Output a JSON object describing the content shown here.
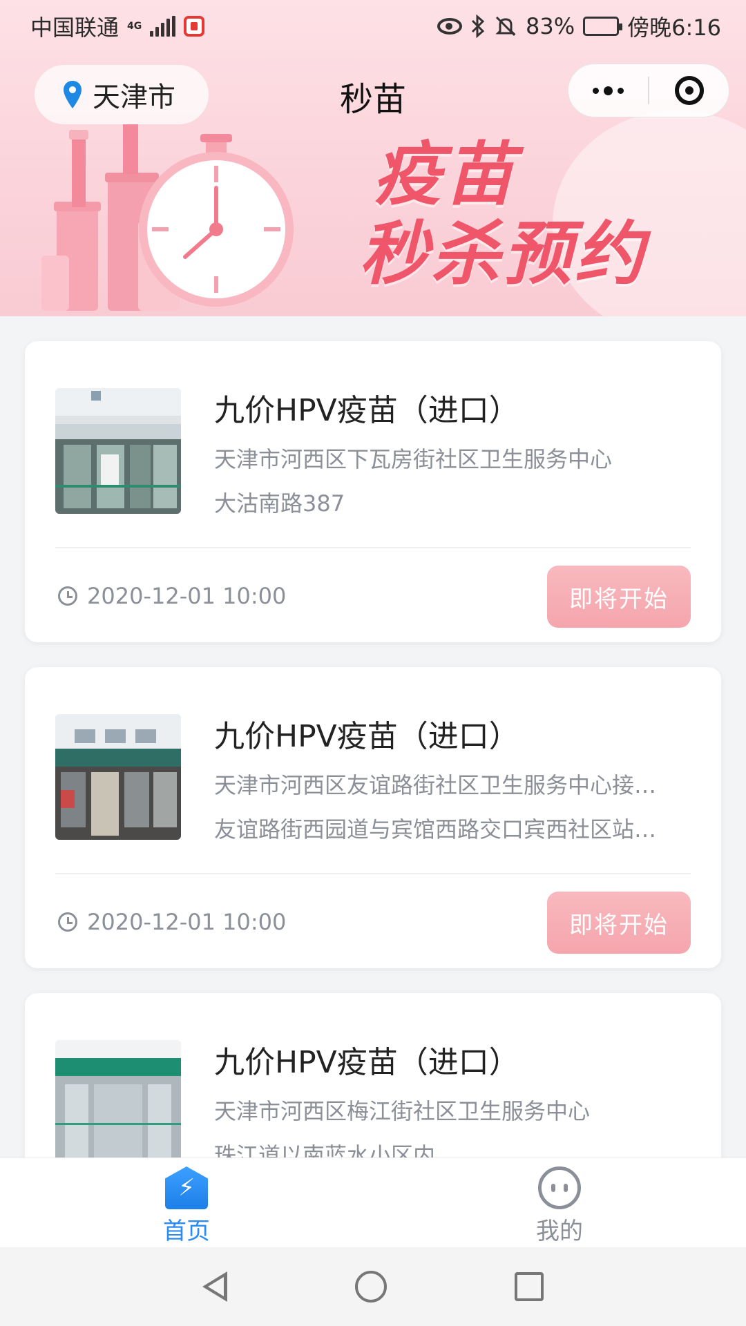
{
  "status_bar": {
    "carrier": "中国联通",
    "network": "4G",
    "battery": "83%",
    "time": "傍晚6:16"
  },
  "header": {
    "city": "天津市",
    "title": "秒苗"
  },
  "banner": {
    "line1": "疫苗",
    "line2": "秒杀预约"
  },
  "cards": [
    {
      "title": "九价HPV疫苗（进口）",
      "clinic": "天津市河西区下瓦房街社区卫生服务中心",
      "address": "大沽南路387",
      "time": "2020-12-01 10:00",
      "button": "即将开始"
    },
    {
      "title": "九价HPV疫苗（进口）",
      "clinic": "天津市河西区友谊路街社区卫生服务中心接…",
      "address": "友谊路街西园道与宾馆西路交口宾西社区站…",
      "time": "2020-12-01 10:00",
      "button": "即将开始"
    },
    {
      "title": "九价HPV疫苗（进口）",
      "clinic": "天津市河西区梅江街社区卫生服务中心",
      "address": "珠江道以南蓝水小区内",
      "time": "",
      "button": ""
    }
  ],
  "tabbar": {
    "home_label": "首页",
    "mine_label": "我的"
  },
  "colors": {
    "accent_blue": "#2a8bf2",
    "button_pink": "#f5a5ad",
    "banner_text": "#f0566a"
  }
}
